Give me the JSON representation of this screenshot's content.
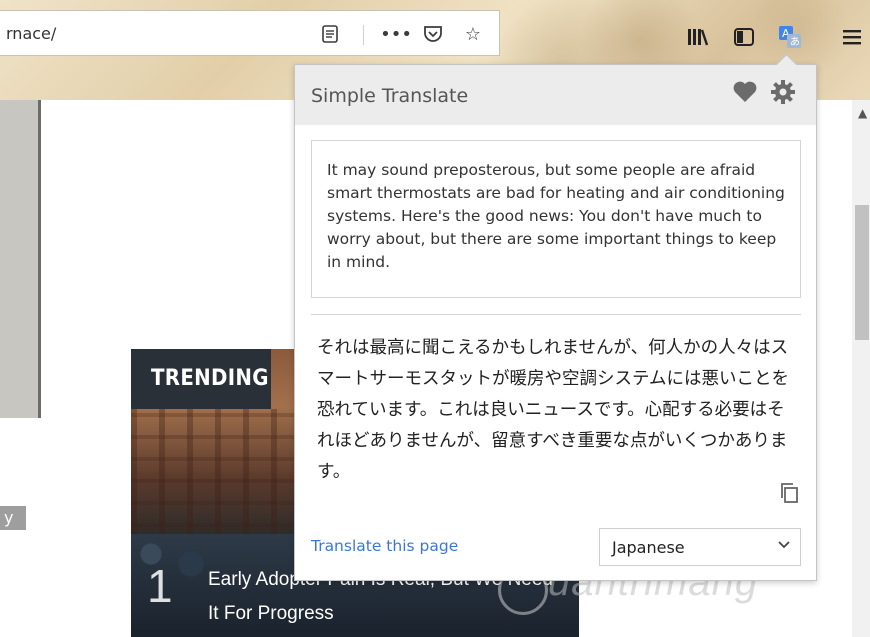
{
  "browser": {
    "url_fragment": "rnace/",
    "icons": [
      "reader-view-icon",
      "more-icon",
      "pocket-icon",
      "bookmark-star-icon",
      "library-icon",
      "sidebar-icon",
      "translate-extension-icon",
      "menu-icon"
    ]
  },
  "page": {
    "side_tag": "y",
    "trending": {
      "label": "TRENDING",
      "number": "1",
      "title": "Early Adopter Pain Is Real, But We Need It For Progress"
    },
    "watermark": "uantrimang"
  },
  "popup": {
    "title": "Simple Translate",
    "source_text": "It may sound preposterous, but some people are afraid smart thermostats are bad for heating and air conditioning systems. Here's the good news: You don't have much to worry about, but there are some important things to keep in mind.",
    "result_text": "それは最高に聞こえるかもしれませんが、何人かの人々はスマートサーモスタットが暖房や空調システムには悪いことを恐れています。これは良いニュースです。心配する必要はそれほどありませんが、留意すべき重要な点がいくつかあります。",
    "translate_page_link": "Translate this page",
    "target_language": "Japanese",
    "colors": {
      "link": "#3a78d8",
      "header_bg": "#ececec"
    }
  }
}
